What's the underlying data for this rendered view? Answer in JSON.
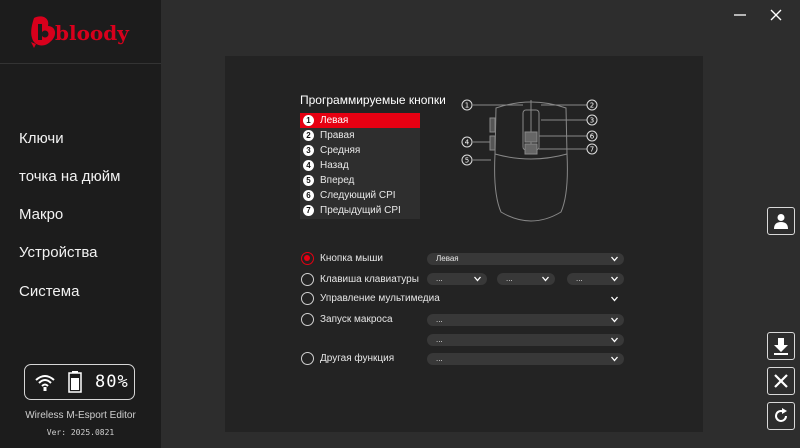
{
  "brand": {
    "logo_text": "bloody"
  },
  "nav": [
    {
      "label": "Ключи",
      "active": true
    },
    {
      "label": "точка на дюйм",
      "active": false
    },
    {
      "label": "Макро",
      "active": false
    },
    {
      "label": "Устройства",
      "active": false
    },
    {
      "label": "Система",
      "active": false
    }
  ],
  "status": {
    "battery_percent": "80%",
    "battery_level": 0.8
  },
  "footer": {
    "app_name": "Wireless M-Esport Editor",
    "version": "Ver: 2025.0821"
  },
  "buttons_panel": {
    "title": "Программируемые кнопки",
    "items": [
      {
        "num": "1",
        "label": "Левая",
        "selected": true
      },
      {
        "num": "2",
        "label": "Правая",
        "selected": false
      },
      {
        "num": "3",
        "label": "Средняя",
        "selected": false
      },
      {
        "num": "4",
        "label": "Назад",
        "selected": false
      },
      {
        "num": "5",
        "label": "Вперед",
        "selected": false
      },
      {
        "num": "6",
        "label": "Следующий CPI",
        "selected": false
      },
      {
        "num": "7",
        "label": "Предыдущий CPI",
        "selected": false
      }
    ],
    "diagram_labels": [
      "1",
      "2",
      "3",
      "4",
      "5",
      "6",
      "7"
    ]
  },
  "functions": {
    "mouse_button": {
      "label": "Кнопка мыши",
      "checked": true,
      "value": "Левая"
    },
    "keyboard_key": {
      "label": "Клавиша клавиатуры",
      "checked": false,
      "values": [
        "...",
        "...",
        "..."
      ]
    },
    "multimedia": {
      "label": "Управление мультимедиа",
      "checked": false,
      "value": "..."
    },
    "macro": {
      "label": "Запуск макроса",
      "checked": false,
      "values": [
        "...",
        "..."
      ]
    },
    "other": {
      "label": "Другая функция",
      "checked": false,
      "value": "..."
    }
  },
  "colors": {
    "accent": "#e60012",
    "sidebar": "#1c1c1c",
    "background": "#2d2d2d",
    "panel": "#232323"
  },
  "icons": {
    "window": [
      "minimize-icon",
      "close-icon"
    ],
    "side": [
      "user-icon",
      "download-icon",
      "close-icon",
      "refresh-icon"
    ]
  }
}
